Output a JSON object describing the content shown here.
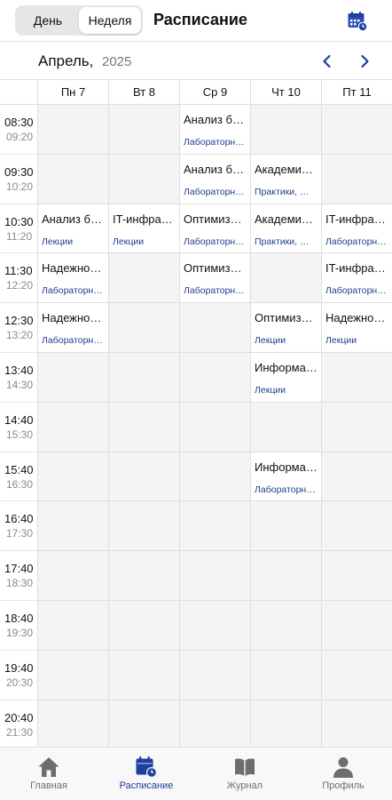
{
  "header": {
    "view_day": "День",
    "view_week": "Неделя",
    "active_view": "Неделя",
    "title": "Расписание",
    "calendar_icon": "calendar-clock-icon"
  },
  "month_bar": {
    "month": "Апрель,",
    "year": "2025",
    "prev_icon": "chevron-left-icon",
    "next_icon": "chevron-right-icon"
  },
  "days": [
    "Пн 7",
    "Вт 8",
    "Ср 9",
    "Чт 10",
    "Пт 11"
  ],
  "slots": [
    {
      "start": "08:30",
      "end": "09:20"
    },
    {
      "start": "09:30",
      "end": "10:20"
    },
    {
      "start": "10:30",
      "end": "11:20"
    },
    {
      "start": "11:30",
      "end": "12:20"
    },
    {
      "start": "12:30",
      "end": "13:20"
    },
    {
      "start": "13:40",
      "end": "14:30"
    },
    {
      "start": "14:40",
      "end": "15:30"
    },
    {
      "start": "15:40",
      "end": "16:30"
    },
    {
      "start": "16:40",
      "end": "17:30"
    },
    {
      "start": "17:40",
      "end": "18:30"
    },
    {
      "start": "18:40",
      "end": "19:30"
    },
    {
      "start": "19:40",
      "end": "20:30"
    },
    {
      "start": "20:40",
      "end": "21:30"
    }
  ],
  "lessons": [
    {
      "day": 2,
      "slot": 0,
      "name": "Анализ б…",
      "type": "Лабораторн…"
    },
    {
      "day": 2,
      "slot": 1,
      "name": "Анализ б…",
      "type": "Лабораторн…"
    },
    {
      "day": 3,
      "slot": 1,
      "name": "Академи…",
      "type": "Практики, …"
    },
    {
      "day": 0,
      "slot": 2,
      "name": "Анализ б…",
      "type": "Лекции"
    },
    {
      "day": 1,
      "slot": 2,
      "name": "IT-инфрас…",
      "type": "Лекции"
    },
    {
      "day": 2,
      "slot": 2,
      "name": "Оптимиз…",
      "type": "Лабораторн…"
    },
    {
      "day": 3,
      "slot": 2,
      "name": "Академи…",
      "type": "Практики, …"
    },
    {
      "day": 4,
      "slot": 2,
      "name": "IT-инфрас…",
      "type": "Лабораторн…"
    },
    {
      "day": 0,
      "slot": 3,
      "name": "Надежно…",
      "type": "Лабораторн…"
    },
    {
      "day": 2,
      "slot": 3,
      "name": "Оптимиз…",
      "type": "Лабораторн…"
    },
    {
      "day": 4,
      "slot": 3,
      "name": "IT-инфрас…",
      "type": "Лабораторн…"
    },
    {
      "day": 0,
      "slot": 4,
      "name": "Надежно…",
      "type": "Лабораторн…"
    },
    {
      "day": 3,
      "slot": 4,
      "name": "Оптимиз…",
      "type": "Лекции"
    },
    {
      "day": 4,
      "slot": 4,
      "name": "Надежно…",
      "type": "Лекции"
    },
    {
      "day": 3,
      "slot": 5,
      "name": "Информа…",
      "type": "Лекции"
    },
    {
      "day": 3,
      "slot": 7,
      "name": "Информа…",
      "type": "Лабораторн…"
    }
  ],
  "bottom_nav": [
    {
      "label": "Главная",
      "icon": "home-icon",
      "active": false
    },
    {
      "label": "Расписание",
      "icon": "calendar-clock-icon",
      "active": true
    },
    {
      "label": "Журнал",
      "icon": "book-icon",
      "active": false
    },
    {
      "label": "Профиль",
      "icon": "person-icon",
      "active": false
    }
  ],
  "colors": {
    "accent": "#1e3f9c",
    "lesson_type": "#1e3f8c",
    "empty_cell": "#f4f4f4",
    "inactive_nav": "#6d6d6d"
  }
}
